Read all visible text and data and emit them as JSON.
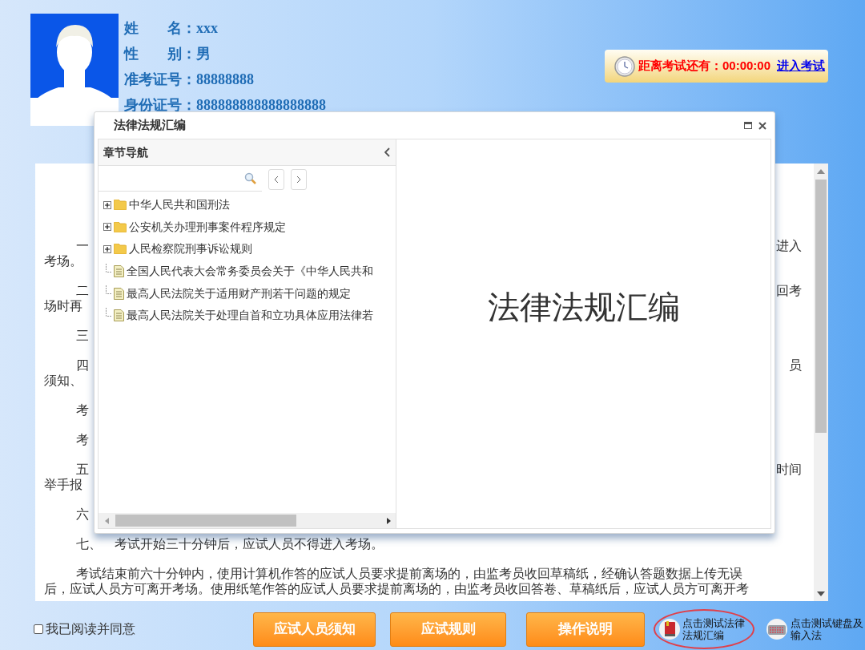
{
  "candidate": {
    "fields": [
      {
        "label": "姓　　名：",
        "value": "xxx"
      },
      {
        "label": "性　　别：",
        "value": "男"
      },
      {
        "label": "准考证号：",
        "value": "88888888"
      },
      {
        "label": "身份证号：",
        "value": "888888888888888888"
      }
    ]
  },
  "countdown": {
    "label": "距离考试还有：00:00:00",
    "link": "进入考试"
  },
  "notice": {
    "rows": [
      {
        "kind": "para",
        "left": "一",
        "right": "进入"
      },
      {
        "kind": "cont",
        "left": "考场。",
        "right": ""
      },
      {
        "kind": "para",
        "left": "二",
        "right": "回考"
      },
      {
        "kind": "cont",
        "left": "场时再",
        "right": ""
      },
      {
        "kind": "para",
        "left": "三",
        "right": ""
      },
      {
        "kind": "para",
        "left": "四",
        "right": "员"
      },
      {
        "kind": "cont",
        "left": "须知、",
        "right": ""
      },
      {
        "kind": "para",
        "left": "考",
        "right": ""
      },
      {
        "kind": "para",
        "left": "考",
        "right": ""
      },
      {
        "kind": "para",
        "left": "五",
        "right": "时间"
      },
      {
        "kind": "cont",
        "left": "举手报",
        "right": ""
      },
      {
        "kind": "para",
        "left": "六",
        "right": ""
      },
      {
        "kind": "para",
        "left": "七、　考试开始三十分钟后，应试人员不得进入考场。",
        "right": ""
      },
      {
        "kind": "para",
        "left": "考试结束前六十分钟内，使用计算机作答的应试人员要求提前离场的，由监考员收回草稿纸，经确认答题数据上传无误",
        "right": ""
      },
      {
        "kind": "cont",
        "left": "后，应试人员方可离开考场。使用纸笔作答的应试人员要求提前离场的，由监考员收回答卷、草稿纸后，应试人员方可离开考",
        "right": ""
      }
    ]
  },
  "dialog": {
    "title": "法律法规汇编",
    "nav_title": "章节导航",
    "tree": [
      {
        "kind": "folder",
        "expanded": false,
        "label": "中华人民共和国刑法"
      },
      {
        "kind": "folder",
        "expanded": false,
        "label": "公安机关办理刑事案件程序规定"
      },
      {
        "kind": "folder",
        "expanded": false,
        "label": "人民检察院刑事诉讼规则"
      },
      {
        "kind": "file",
        "label": "全国人民代表大会常务委员会关于《中华人民共和"
      },
      {
        "kind": "file",
        "label": "最高人民法院关于适用财产刑若干问题的规定"
      },
      {
        "kind": "file",
        "label": "最高人民法院关于处理自首和立功具体应用法律若"
      }
    ],
    "content_title": "法律法规汇编"
  },
  "footer": {
    "agree": {
      "label": "我已阅读并同意",
      "checked": false
    },
    "buttons": [
      "应试人员须知",
      "应试规则",
      "操作说明"
    ],
    "tools": [
      {
        "kind": "law",
        "label": "点击测试法律法规汇编",
        "highlighted": true
      },
      {
        "kind": "keyboard",
        "label": "点击测试键盘及输入法",
        "highlighted": false
      }
    ]
  }
}
